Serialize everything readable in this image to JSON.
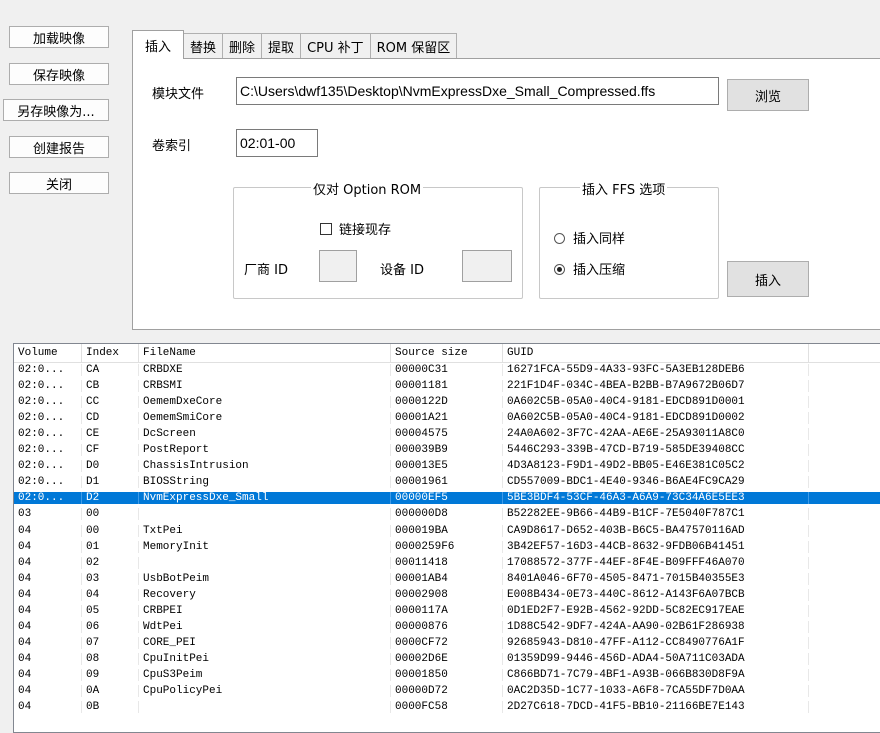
{
  "sidebar": {
    "load": "加载映像",
    "save": "保存映像",
    "save_as": "另存映像为...",
    "report": "创建报告",
    "close": "关闭"
  },
  "tabs": [
    "插入",
    "替换",
    "删除",
    "提取",
    "CPU 补丁",
    "ROM 保留区"
  ],
  "insert_panel": {
    "module_file_label": "模块文件",
    "module_file_value": "C:\\Users\\dwf135\\Desktop\\NvmExpressDxe_Small_Compressed.ffs",
    "browse": "浏览",
    "volume_label": "卷索引",
    "volume_value": "02:01-00",
    "option_rom_group": "仅对 Option ROM",
    "link_mem": "链接现存",
    "vendor_id": "厂商 ID",
    "device_id": "设备 ID",
    "ffs_group": "插入 FFS 选项",
    "insert_same": "插入同样",
    "insert_compressed": "插入压缩",
    "insert_button": "插入"
  },
  "table": {
    "columns": [
      "Volume",
      "Index",
      "FileName",
      "Source size",
      "GUID"
    ],
    "rows": [
      [
        "02:0...",
        "CA",
        "CRBDXE",
        "00000C31",
        "16271FCA-55D9-4A33-93FC-5A3EB128DEB6"
      ],
      [
        "02:0...",
        "CB",
        "CRBSMI",
        "00001181",
        "221F1D4F-034C-4BEA-B2BB-B7A9672B06D7"
      ],
      [
        "02:0...",
        "CC",
        "OememDxeCore",
        "0000122D",
        "0A602C5B-05A0-40C4-9181-EDCD891D0001"
      ],
      [
        "02:0...",
        "CD",
        "OememSmiCore",
        "00001A21",
        "0A602C5B-05A0-40C4-9181-EDCD891D0002"
      ],
      [
        "02:0...",
        "CE",
        "DcScreen",
        "00004575",
        "24A0A602-3F7C-42AA-AE6E-25A93011A8C0"
      ],
      [
        "02:0...",
        "CF",
        "PostReport",
        "000039B9",
        "5446C293-339B-47CD-B719-585DE39408CC"
      ],
      [
        "02:0...",
        "D0",
        "ChassisIntrusion",
        "000013E5",
        "4D3A8123-F9D1-49D2-BB05-E46E381C05C2"
      ],
      [
        "02:0...",
        "D1",
        "BIOSString",
        "00001961",
        "CD557009-BDC1-4E40-9346-B6AE4FC9CA29"
      ],
      [
        "02:0...",
        "D2",
        "NvmExpressDxe_Small",
        "00000EF5",
        "5BE3BDF4-53CF-46A3-A6A9-73C34A6E5EE3"
      ],
      [
        "03",
        "00",
        "",
        "000000D8",
        "B52282EE-9B66-44B9-B1CF-7E5040F787C1"
      ],
      [
        "04",
        "00",
        "TxtPei",
        "000019BA",
        "CA9D8617-D652-403B-B6C5-BA47570116AD"
      ],
      [
        "04",
        "01",
        "MemoryInit",
        "0000259F6",
        "3B42EF57-16D3-44CB-8632-9FDB06B41451"
      ],
      [
        "04",
        "02",
        "",
        "00011418",
        "17088572-377F-44EF-8F4E-B09FFF46A070"
      ],
      [
        "04",
        "03",
        "UsbBotPeim",
        "00001AB4",
        "8401A046-6F70-4505-8471-7015B40355E3"
      ],
      [
        "04",
        "04",
        "Recovery",
        "00002908",
        "E008B434-0E73-440C-8612-A143F6A07BCB"
      ],
      [
        "04",
        "05",
        "CRBPEI",
        "0000117A",
        "0D1ED2F7-E92B-4562-92DD-5C82EC917EAE"
      ],
      [
        "04",
        "06",
        "WdtPei",
        "00000876",
        "1D88C542-9DF7-424A-AA90-02B61F286938"
      ],
      [
        "04",
        "07",
        "CORE_PEI",
        "0000CF72",
        "92685943-D810-47FF-A112-CC8490776A1F"
      ],
      [
        "04",
        "08",
        "CpuInitPei",
        "00002D6E",
        "01359D99-9446-456D-ADA4-50A711C03ADA"
      ],
      [
        "04",
        "09",
        "CpuS3Peim",
        "00001850",
        "C866BD71-7C79-4BF1-A93B-066B830D8F9A"
      ],
      [
        "04",
        "0A",
        "CpuPolicyPei",
        "00000D72",
        "0AC2D35D-1C77-1033-A6F8-7CA55DF7D0AA"
      ],
      [
        "04",
        "0B",
        "",
        "0000FC58",
        "2D27C618-7DCD-41F5-BB10-21166BE7E143"
      ]
    ],
    "selected_row": 8
  }
}
